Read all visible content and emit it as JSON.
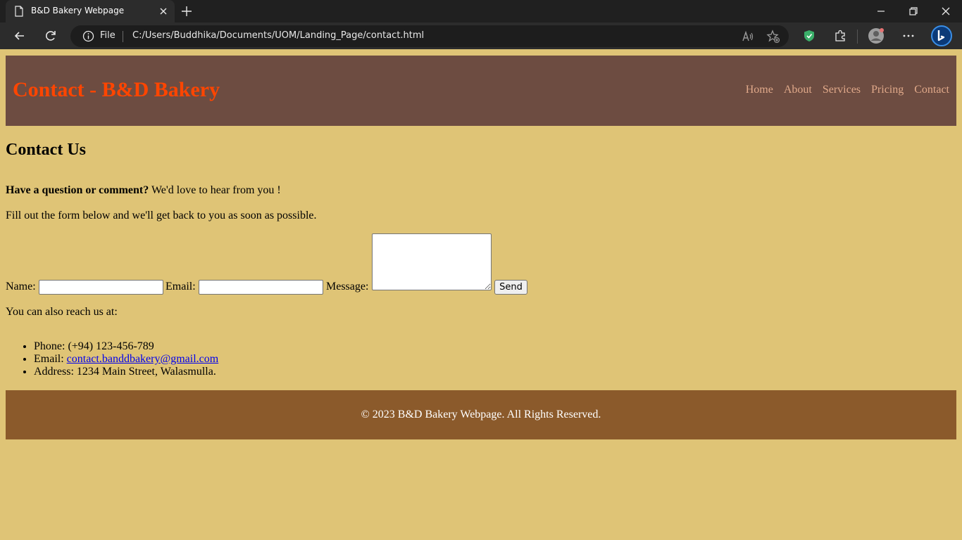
{
  "browser": {
    "tab_title": "B&D Bakery Webpage",
    "address_scheme": "File",
    "address_url": "C:/Users/Buddhika/Documents/UOM/Landing_Page/contact.html"
  },
  "site": {
    "title": "Contact - B&D Bakery",
    "nav": [
      "Home",
      "About",
      "Services",
      "Pricing",
      "Contact"
    ],
    "heading": "Contact Us",
    "intro_bold": "Have a question or comment?",
    "intro_rest": " We'd love to hear from you !",
    "instruction": "Fill out the form below and we'll get back to you as soon as possible.",
    "form": {
      "name_label": "Name:",
      "email_label": "Email:",
      "message_label": "Message:",
      "name_value": "",
      "email_value": "",
      "message_value": "",
      "send_label": "Send"
    },
    "reach_text": "You can also reach us at:",
    "contact": {
      "phone": "Phone: (+94) 123-456-789",
      "email_prefix": "Email: ",
      "email_link": "contact.banddbakery@gmail.com",
      "address": "Address: 1234 Main Street, Walasmulla."
    },
    "footer": "© 2023 B&D Bakery Webpage. All Rights Reserved."
  }
}
